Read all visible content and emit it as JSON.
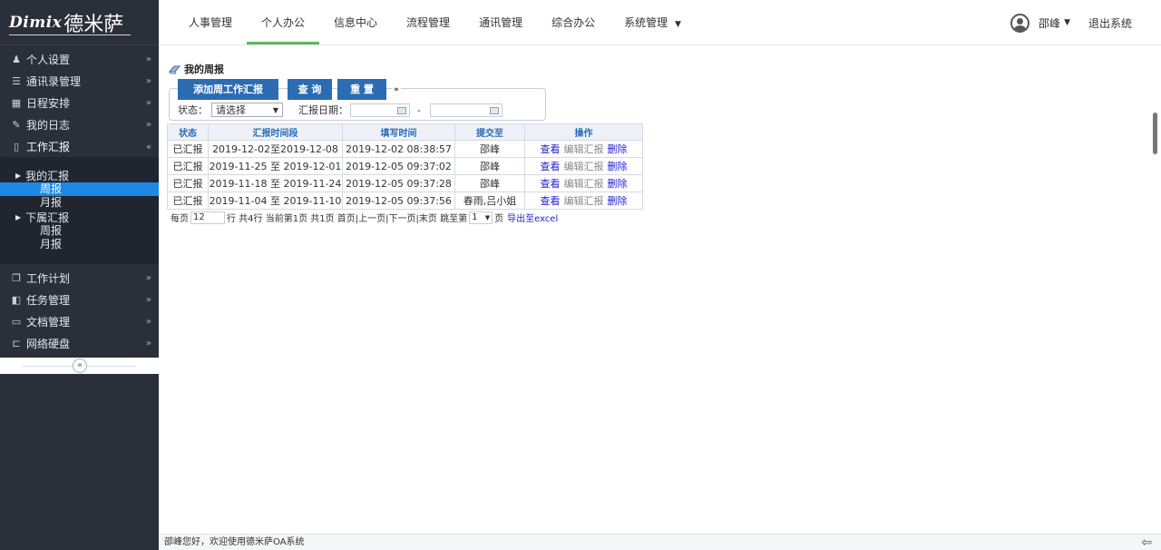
{
  "logo": {
    "mark": "Dimix",
    "cn": "德米萨"
  },
  "sidebar": {
    "items_top": [
      {
        "icon": "person-icon",
        "glyph": "♟",
        "label": "个人设置"
      },
      {
        "icon": "list-icon",
        "glyph": "☰",
        "label": "通讯录管理"
      },
      {
        "icon": "calendar-icon",
        "glyph": "▦",
        "label": "日程安排"
      },
      {
        "icon": "pencil-icon",
        "glyph": "✎",
        "label": "我的日志"
      },
      {
        "icon": "document-icon",
        "glyph": "▯",
        "label": "工作汇报"
      }
    ],
    "submenu": {
      "my_report": "我的汇报",
      "my_weekly": "周报",
      "my_monthly": "月报",
      "sub_report": "下属汇报",
      "sub_weekly": "周报",
      "sub_monthly": "月报"
    },
    "items_bottom": [
      {
        "icon": "copy-icon",
        "glyph": "❐",
        "label": "工作计划"
      },
      {
        "icon": "task-icon",
        "glyph": "◧",
        "label": "任务管理"
      },
      {
        "icon": "folder-icon",
        "glyph": "▭",
        "label": "文档管理"
      },
      {
        "icon": "folder-open-icon",
        "glyph": "⊏",
        "label": "网络硬盘"
      }
    ],
    "collapse_glyph": "«"
  },
  "topnav": {
    "tabs": [
      "人事管理",
      "个人办公",
      "信息中心",
      "流程管理",
      "通讯管理",
      "综合办公",
      "系统管理"
    ],
    "active_index": 1,
    "user": "邵峰",
    "logout": "退出系统"
  },
  "page": {
    "title": "我的周报",
    "buttons": {
      "add": "添加周工作汇报",
      "query": "查 询",
      "reset": "重 置"
    },
    "filter": {
      "status_label": "状态：",
      "status_value": "请选择",
      "date_label": "汇报日期：",
      "dash": "-"
    },
    "table": {
      "headers": [
        "状态",
        "汇报时间段",
        "填写时间",
        "提交至",
        "操作"
      ],
      "rows": [
        {
          "status": "已汇报",
          "period": "2019-12-02至2019-12-08",
          "filled": "2019-12-02 08:38:57",
          "to": "邵峰"
        },
        {
          "status": "已汇报",
          "period": "2019-11-25 至 2019-12-01",
          "filled": "2019-12-05 09:37:02",
          "to": "邵峰"
        },
        {
          "status": "已汇报",
          "period": "2019-11-18 至 2019-11-24",
          "filled": "2019-12-05 09:37:28",
          "to": "邵峰"
        },
        {
          "status": "已汇报",
          "period": "2019-11-04 至 2019-11-10",
          "filled": "2019-12-05 09:37:56",
          "to": "春雨,吕小姐"
        }
      ],
      "ops": {
        "view": "查看",
        "edit": "编辑汇报",
        "del": "删除"
      }
    },
    "pager": {
      "per_page_label": "每页",
      "per_page": "12",
      "summary": "行 共4行  当前第1页  共1页  首页|上一页|下一页|末页  跳至第",
      "page": "1",
      "page_suffix": "页",
      "export": "导出至excel"
    }
  },
  "footer": {
    "text": "邵峰您好，欢迎使用德米萨OA系统",
    "back_glyph": "⇦"
  }
}
